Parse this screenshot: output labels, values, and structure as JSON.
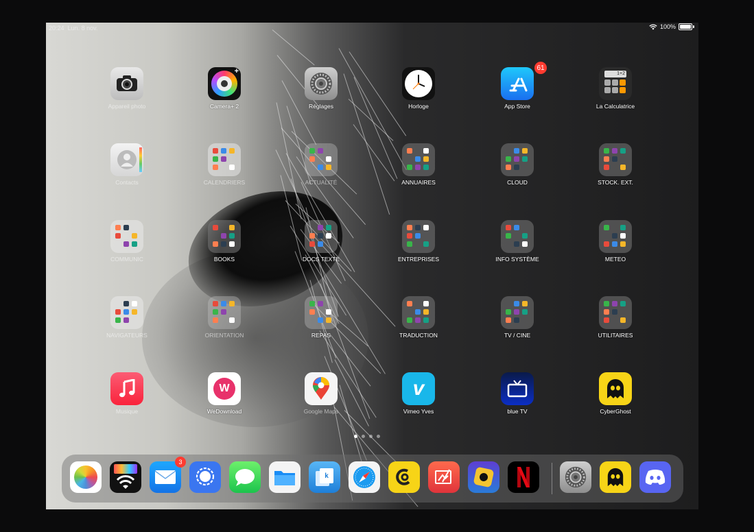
{
  "status_bar": {
    "time": "20:24",
    "date": "Lun. 8 nov.",
    "battery": "100%",
    "icons": [
      "wifi-icon",
      "battery-icon"
    ]
  },
  "apps": [
    {
      "label": "Appareil photo",
      "icon": "camera-icon"
    },
    {
      "label": "Camera+ 2",
      "icon": "camera-plus-icon"
    },
    {
      "label": "Réglages",
      "icon": "settings-gear-icon"
    },
    {
      "label": "Horloge",
      "icon": "clock-icon"
    },
    {
      "label": "App Store",
      "icon": "app-store-icon",
      "badge": "61"
    },
    {
      "label": "La Calculatrice",
      "icon": "calculator-icon"
    },
    {
      "label": "Contacts",
      "icon": "contacts-icon"
    },
    {
      "label": "CALENDRIERS",
      "icon": "folder-icon"
    },
    {
      "label": "ACTUALITÉ",
      "icon": "folder-icon"
    },
    {
      "label": "ANNUAIRES",
      "icon": "folder-icon"
    },
    {
      "label": "CLOUD",
      "icon": "folder-icon"
    },
    {
      "label": "STOCK. EXT.",
      "icon": "folder-icon"
    },
    {
      "label": "COMMUNIC",
      "icon": "folder-icon"
    },
    {
      "label": "BOOKS",
      "icon": "folder-icon"
    },
    {
      "label": "DOCS TEXTE",
      "icon": "folder-icon"
    },
    {
      "label": "ENTREPRISES",
      "icon": "folder-icon"
    },
    {
      "label": "INFO SYSTÈME",
      "icon": "folder-icon"
    },
    {
      "label": "METEO",
      "icon": "folder-icon"
    },
    {
      "label": "NAVIGATEURS",
      "icon": "folder-icon"
    },
    {
      "label": "ORIENTATION",
      "icon": "folder-icon"
    },
    {
      "label": "REPAS",
      "icon": "folder-icon"
    },
    {
      "label": "TRADUCTION",
      "icon": "folder-icon"
    },
    {
      "label": "TV / CINE",
      "icon": "folder-icon"
    },
    {
      "label": "UTILITAIRES",
      "icon": "folder-icon"
    },
    {
      "label": "Musique",
      "icon": "music-icon"
    },
    {
      "label": "WeDownload",
      "icon": "wedownload-icon"
    },
    {
      "label": "Google Maps",
      "icon": "google-maps-icon"
    },
    {
      "label": "Vimeo Yves",
      "icon": "vimeo-icon"
    },
    {
      "label": "blue TV",
      "icon": "tv-icon"
    },
    {
      "label": "CyberGhost",
      "icon": "ghost-icon"
    }
  ],
  "page_dots": {
    "count": 4,
    "active": 1
  },
  "dock": [
    {
      "icon": "photos-icon"
    },
    {
      "icon": "wifi-photo-icon"
    },
    {
      "icon": "mail-icon",
      "badge": "3"
    },
    {
      "icon": "signal-icon"
    },
    {
      "icon": "messages-icon"
    },
    {
      "icon": "files-icon"
    },
    {
      "icon": "documents-icon"
    },
    {
      "icon": "safari-icon"
    },
    {
      "icon": "chameleon-icon"
    },
    {
      "icon": "art-icon"
    },
    {
      "icon": "disney-puzzle-icon"
    },
    {
      "icon": "netflix-icon"
    },
    {
      "icon": "settings-gear-icon"
    },
    {
      "icon": "ghost-icon"
    },
    {
      "icon": "discord-icon"
    }
  ],
  "colors": {
    "badge": "#ff3b30",
    "dock": "#6e6e6e"
  }
}
